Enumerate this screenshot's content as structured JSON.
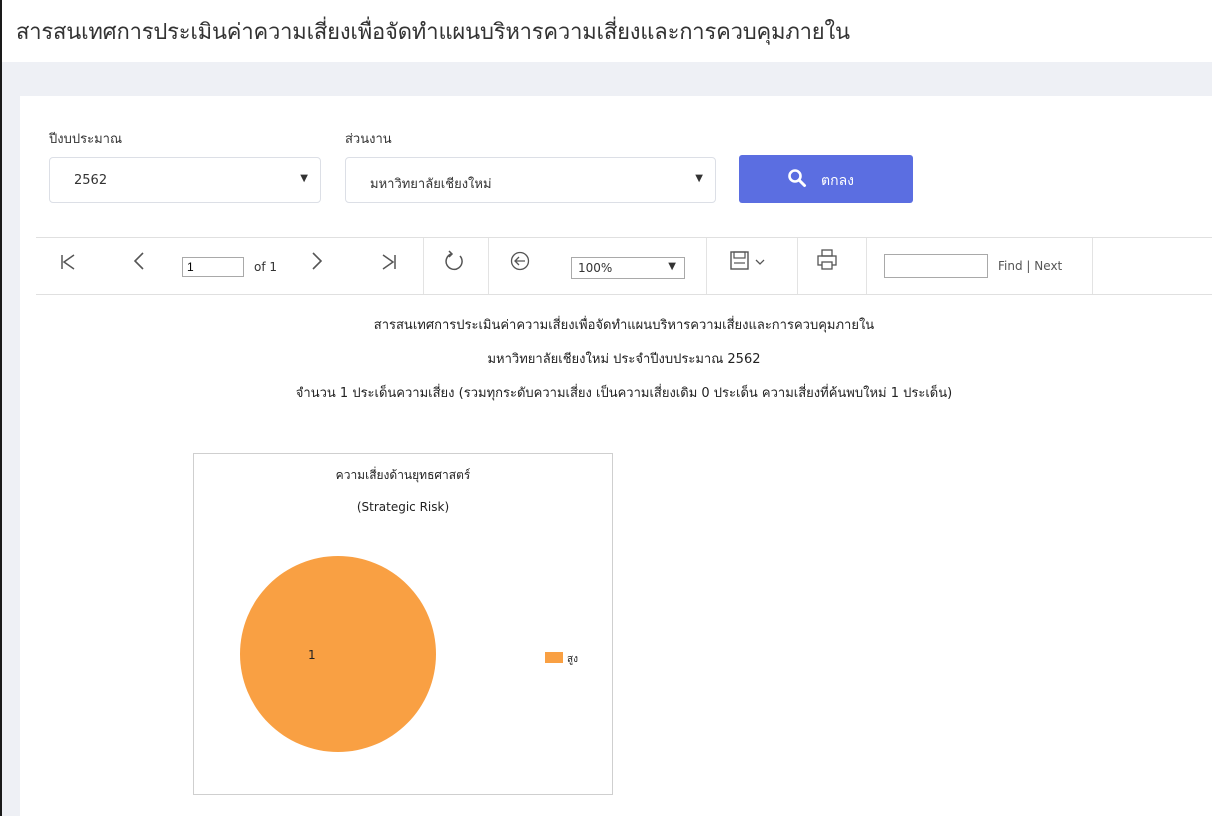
{
  "header": {
    "title": "สารสนเทศการประเมินค่าความเสี่ยงเพื่อจัดทำแผนบริหารความเสี่ยงและการควบคุมภายใน"
  },
  "filters": {
    "year_label": "ปีงบประมาณ",
    "year_value": "2562",
    "unit_label": "ส่วนงาน",
    "unit_value": "มหาวิทยาลัยเชียงใหม่",
    "ok_label": "ตกลง"
  },
  "toolbar": {
    "page_value": "1",
    "of_label": "of 1",
    "zoom_value": "100%",
    "find_label": "Find",
    "separator": "|",
    "next_label": "Next"
  },
  "report": {
    "title": "สารสนเทศการประเมินค่าความเสี่ยงเพื่อจัดทำแผนบริหารความเสี่ยงและการควบคุมภายใน",
    "subtitle": "มหาวิทยาลัยเชียงใหม่ ประจำปีงบประมาณ 2562",
    "summary": "จำนวน 1 ประเด็นความเสี่ยง (รวมทุกระดับความเสี่ยง เป็นความเสี่ยงเดิม 0 ประเด็น ความเสี่ยงที่ค้นพบใหม่ 1 ประเด็น)"
  },
  "colors": {
    "accent": "#5b6ee1",
    "pie_high": "#f9a043"
  },
  "chart_data": {
    "type": "pie",
    "title": "ความเสี่ยงด้านยุทธศาสตร์",
    "subtitle": "(Strategic Risk)",
    "categories": [
      "สูง"
    ],
    "values": [
      1
    ],
    "data_labels": [
      "1"
    ],
    "legend": "right"
  }
}
